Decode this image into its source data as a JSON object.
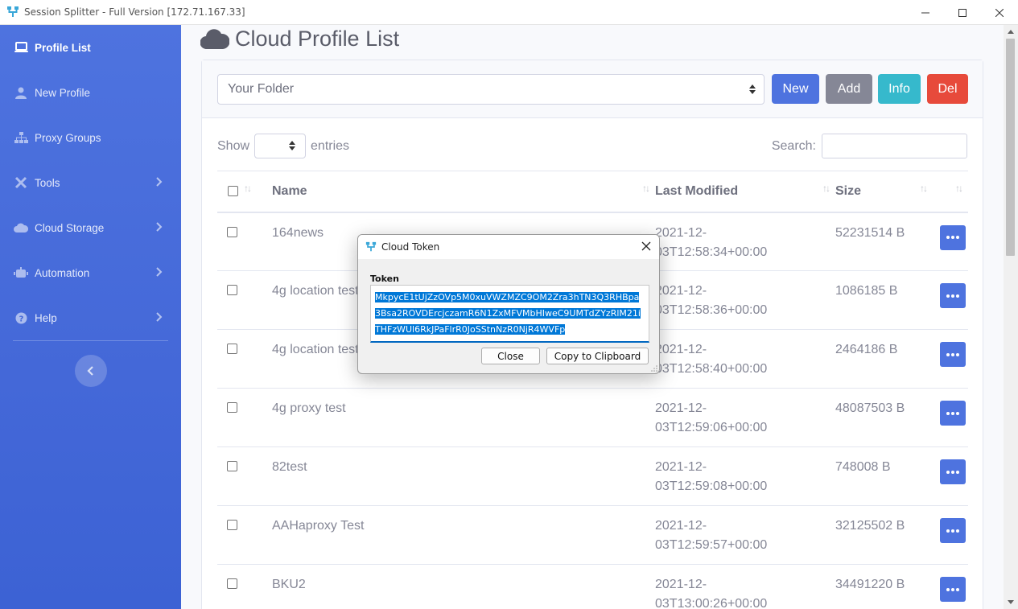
{
  "window": {
    "title": "Session Splitter - Full Version [172.71.167.33]"
  },
  "sidebar": {
    "items": [
      {
        "label": "Profile List",
        "icon": "laptop-icon",
        "active": true
      },
      {
        "label": "New Profile",
        "icon": "user-icon"
      },
      {
        "label": "Proxy Groups",
        "icon": "sitemap-icon"
      },
      {
        "label": "Tools",
        "icon": "tools-icon",
        "has_submenu": true
      },
      {
        "label": "Cloud Storage",
        "icon": "cloud-icon",
        "has_submenu": true
      },
      {
        "label": "Automation",
        "icon": "robot-icon",
        "has_submenu": true
      },
      {
        "label": "Help",
        "icon": "question-circle-icon",
        "has_submenu": true
      }
    ]
  },
  "page": {
    "title": "Cloud Profile List"
  },
  "toolbar": {
    "folder_value": "Your Folder",
    "new_label": "New",
    "add_label": "Add",
    "info_label": "Info",
    "del_label": "Del"
  },
  "table_controls": {
    "show_label": "Show",
    "entries_label": "entries",
    "search_label": "Search:"
  },
  "table": {
    "columns": [
      "Name",
      "Last Modified",
      "Size"
    ],
    "rows": [
      {
        "name": "164news",
        "modified_1": "2021-12-",
        "modified_2": "03T12:58:34+00:00",
        "size": "52231514 B"
      },
      {
        "name": "4g location test",
        "modified_1": "2021-12-",
        "modified_2": "03T12:58:36+00:00",
        "size": "1086185 B"
      },
      {
        "name": "4g location test",
        "modified_1": "2021-12-",
        "modified_2": "03T12:58:40+00:00",
        "size": "2464186 B"
      },
      {
        "name": "4g proxy test",
        "modified_1": "2021-12-",
        "modified_2": "03T12:59:06+00:00",
        "size": "48087503 B"
      },
      {
        "name": "82test",
        "modified_1": "2021-12-",
        "modified_2": "03T12:59:08+00:00",
        "size": "748008 B"
      },
      {
        "name": "AAHaproxy Test",
        "modified_1": "2021-12-",
        "modified_2": "03T12:59:57+00:00",
        "size": "32125502 B"
      },
      {
        "name": "BKU2",
        "modified_1": "2021-12-",
        "modified_2": "03T13:00:26+00:00",
        "size": "34491220 B"
      }
    ]
  },
  "dialog": {
    "title": "Cloud Token",
    "label": "Token",
    "token": "MkpycE1tUjZzOVp5M0xuVWZMZC9OM2Zra3hTN3Q3RHBpa3Bsa2ROVDErcjczamR6N1ZxMFVMbHIweC9UMTdZYzRlM21iTHFzWUl6RkJPaFlrR0JoSStnNzR0NjR4WVFp",
    "close_label": "Close",
    "copy_label": "Copy to Clipboard"
  },
  "colors": {
    "primary": "#4e73df",
    "secondary": "#858796",
    "info": "#36b9cc",
    "danger": "#e74a3b"
  }
}
